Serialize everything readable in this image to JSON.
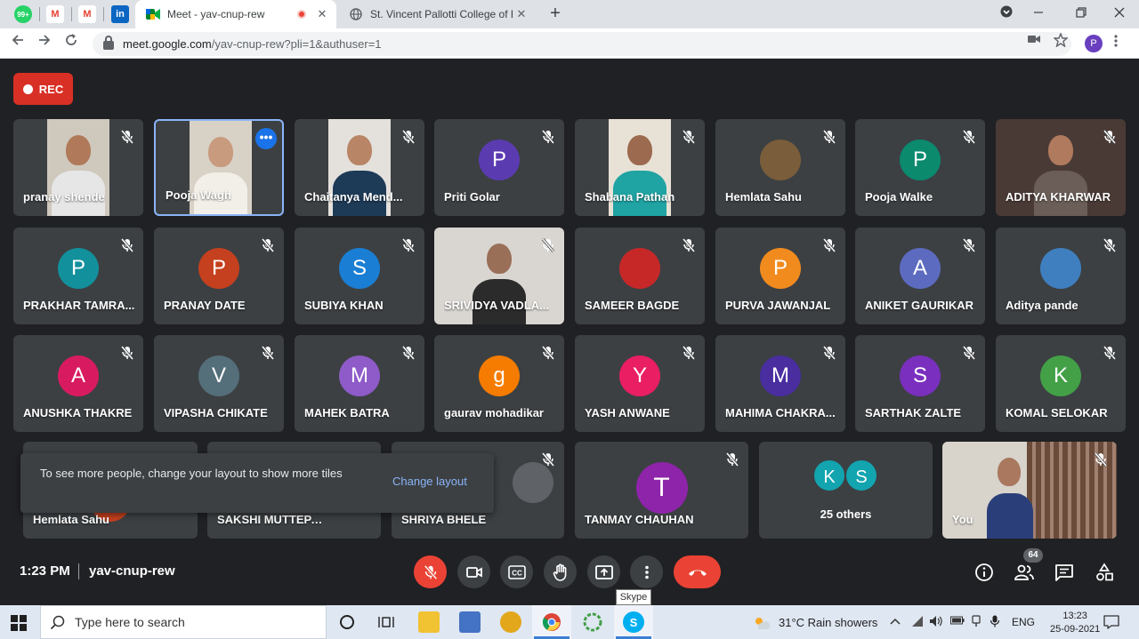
{
  "browser": {
    "pinned_tabs": [
      {
        "icon": "whatsapp-icon",
        "label": "99+",
        "color": "#25d366"
      },
      {
        "icon": "gmail-icon",
        "label": "M",
        "color": "#ea4335"
      },
      {
        "icon": "gmail-icon",
        "label": "M",
        "color": "#ea4335"
      },
      {
        "icon": "linkedin-icon",
        "label": "in",
        "color": "#0a66c2"
      }
    ],
    "tabs": [
      {
        "title": "Meet - yav-cnup-rew",
        "active": true,
        "recording": true,
        "close": "✕"
      },
      {
        "title": "St. Vincent Pallotti College of Eng",
        "active": false,
        "close": "✕"
      }
    ],
    "new_tab": "+",
    "url_host": "meet.google.com",
    "url_path": "/yav-cnup-rew?pli=1&authuser=1",
    "profile_initial": "P",
    "profile_color": "#6a3fbf"
  },
  "meet": {
    "rec_label": "REC",
    "participants": [
      {
        "name": "pranay shende",
        "type": "video",
        "skin": "#b07a5a",
        "shirt": "#e6e6e6",
        "bg": "#cfc8bd"
      },
      {
        "name": "Pooja Wagh",
        "type": "video",
        "skin": "#c89a7e",
        "shirt": "#f2eee8",
        "bg": "#d8d1c6",
        "selected": true
      },
      {
        "name": "Chaitanya Mend...",
        "type": "video",
        "skin": "#b98567",
        "shirt": "#1d3a57",
        "bg": "#e4e1dc"
      },
      {
        "name": "Priti Golar",
        "type": "avatar",
        "initial": "P",
        "color": "#5b3bb0"
      },
      {
        "name": "Shabana Pathan",
        "type": "video",
        "skin": "#9c6a4f",
        "shirt": "#1fa3a3",
        "bg": "#e8e2d6"
      },
      {
        "name": "Hemlata Sahu",
        "type": "photo",
        "color": "#7a5d3a"
      },
      {
        "name": "Pooja Walke",
        "type": "avatar",
        "initial": "P",
        "color": "#0b8a6e"
      },
      {
        "name": "ADITYA KHARWAR",
        "type": "video",
        "skin": "#b07a5e",
        "shirt": "#6b5e58",
        "bg": "#4a3a36"
      },
      {
        "name": "PRAKHAR TAMRA...",
        "type": "avatar",
        "initial": "P",
        "color": "#12909c"
      },
      {
        "name": "PRANAY DATE",
        "type": "avatar",
        "initial": "P",
        "color": "#c5401e"
      },
      {
        "name": "SUBIYA KHAN",
        "type": "avatar",
        "initial": "S",
        "color": "#1a7fd4"
      },
      {
        "name": "SRIVIDYA VADLA...",
        "type": "video",
        "skin": "#9a6f58",
        "shirt": "#2b2b2b",
        "bg": "#d9d6d1"
      },
      {
        "name": "SAMEER BAGDE",
        "type": "photo",
        "color": "#c62828"
      },
      {
        "name": "PURVA JAWANJAL",
        "type": "avatar",
        "initial": "P",
        "color": "#f28b1e"
      },
      {
        "name": "ANIKET GAURIKAR",
        "type": "avatar",
        "initial": "A",
        "color": "#5c6bc0"
      },
      {
        "name": "Aditya pande",
        "type": "photo",
        "color": "#3f7fbf"
      },
      {
        "name": "ANUSHKA THAKRE",
        "type": "avatar",
        "initial": "A",
        "color": "#d81b60"
      },
      {
        "name": "VIPASHA CHIKATE",
        "type": "avatar",
        "initial": "V",
        "color": "#546e7a"
      },
      {
        "name": "MAHEK BATRA",
        "type": "avatar",
        "initial": "M",
        "color": "#8e5bc9"
      },
      {
        "name": "gaurav mohadikar",
        "type": "avatar",
        "initial": "g",
        "color": "#f57c00"
      },
      {
        "name": "YASH ANWANE",
        "type": "avatar",
        "initial": "Y",
        "color": "#e91e63"
      },
      {
        "name": "MAHIMA CHAKRA...",
        "type": "avatar",
        "initial": "M",
        "color": "#4a2ea0"
      },
      {
        "name": "SARTHAK ZALTE",
        "type": "avatar",
        "initial": "S",
        "color": "#7b2fbe"
      },
      {
        "name": "KOMAL SELOKAR",
        "type": "avatar",
        "initial": "K",
        "color": "#43a047"
      }
    ],
    "bottom_row": [
      {
        "name": "Hemlata Sahu"
      },
      {
        "name": "SAKSHI MUTTEPAWAR"
      },
      {
        "name": "SHRIYA BHELE"
      },
      {
        "name": "TANMAY CHAUHAN",
        "initial": "T",
        "color": "#8e24aa"
      }
    ],
    "others": {
      "initials": [
        "K",
        "S"
      ],
      "label": "25 others"
    },
    "self_label": "You",
    "toast": {
      "message": "To see more people, change your layout to show more tiles",
      "action": "Change layout"
    },
    "time": "1:23 PM",
    "meeting_code": "yav-cnup-rew",
    "people_count": "64",
    "tooltip": "Skype"
  },
  "taskbar": {
    "search_placeholder": "Type here to search",
    "weather": "31°C  Rain showers",
    "language": "ENG",
    "time": "13:23",
    "date": "25-09-2021"
  }
}
